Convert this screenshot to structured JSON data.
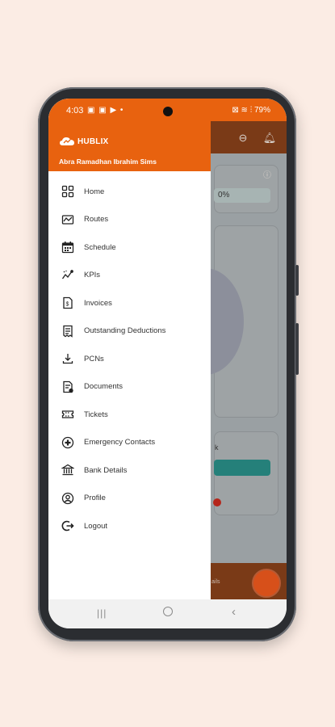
{
  "status_bar": {
    "time": "4:03",
    "indicators": "▣ ▣ ▶ •",
    "right": "⊠ ≋ ⫶ 79%",
    "battery": "79%"
  },
  "app": {
    "brand": "HUBLIX",
    "user_name": "Abra Ramadhan Ibrahim Sims",
    "accent_color": "#e8620f"
  },
  "menu": [
    {
      "label": "Home",
      "icon": "grid-icon"
    },
    {
      "label": "Routes",
      "icon": "map-icon"
    },
    {
      "label": "Schedule",
      "icon": "calendar-icon"
    },
    {
      "label": "KPIs",
      "icon": "chart-icon"
    },
    {
      "label": "Invoices",
      "icon": "invoice-icon"
    },
    {
      "label": "Outstanding Deductions",
      "icon": "receipt-icon"
    },
    {
      "label": "PCNs",
      "icon": "download-icon"
    },
    {
      "label": "Documents",
      "icon": "document-icon"
    },
    {
      "label": "Tickets",
      "icon": "ticket-icon"
    },
    {
      "label": "Emergency Contacts",
      "icon": "emergency-icon"
    },
    {
      "label": "Bank Details",
      "icon": "bank-icon"
    },
    {
      "label": "Profile",
      "icon": "profile-icon"
    },
    {
      "label": "Logout",
      "icon": "logout-icon"
    }
  ],
  "background": {
    "progress_text": "0%",
    "footer_text": "ails",
    "card_label": "k"
  }
}
